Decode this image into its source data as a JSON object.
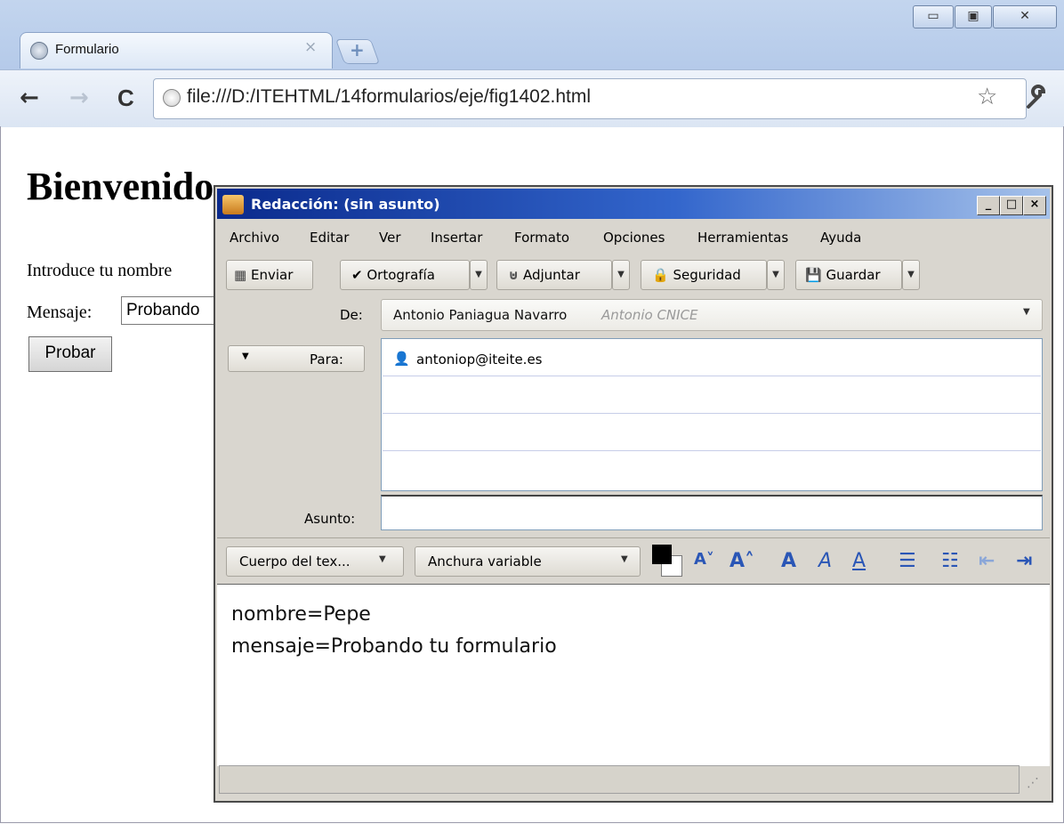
{
  "browser": {
    "tab_title": "Formulario",
    "tab_close": "×",
    "new_tab": "+",
    "url": "file:///D:/ITEHTML/14formularios/eje/fig1402.html",
    "window_buttons": {
      "minimize": "▭",
      "maximize": "▣",
      "close": "✕"
    },
    "nav": {
      "back": "←",
      "forward": "→",
      "reload": "C"
    },
    "star": "☆",
    "wrench": "🔧"
  },
  "page": {
    "heading": "Bienvenido",
    "nombre_label": "Introduce tu nombre",
    "mensaje_label": "Mensaje:",
    "mensaje_value": "Probando",
    "submit_label": "Probar"
  },
  "compose": {
    "title": "Redacción: (sin asunto)",
    "title_buttons": {
      "minimize": "_",
      "maximize": "□",
      "close": "×"
    },
    "menu": [
      "Archivo",
      "Editar",
      "Ver",
      "Insertar",
      "Formato",
      "Opciones",
      "Herramientas",
      "Ayuda"
    ],
    "toolbar": {
      "send": "Enviar",
      "spelling": "Ortografía",
      "attach": "Adjuntar",
      "security": "Seguridad",
      "save": "Guardar"
    },
    "from_label": "De:",
    "from_name": "Antonio Paniagua Navarro",
    "from_account": "Antonio CNICE",
    "to_button": "Para:",
    "to_address": "antoniop@iteite.es",
    "subject_label": "Asunto:",
    "subject_value": "",
    "format": {
      "paragraph": "Cuerpo del tex...",
      "font": "Anchura variable"
    },
    "body_lines": [
      "nombre=Pepe",
      "mensaje=Probando tu formulario"
    ]
  }
}
